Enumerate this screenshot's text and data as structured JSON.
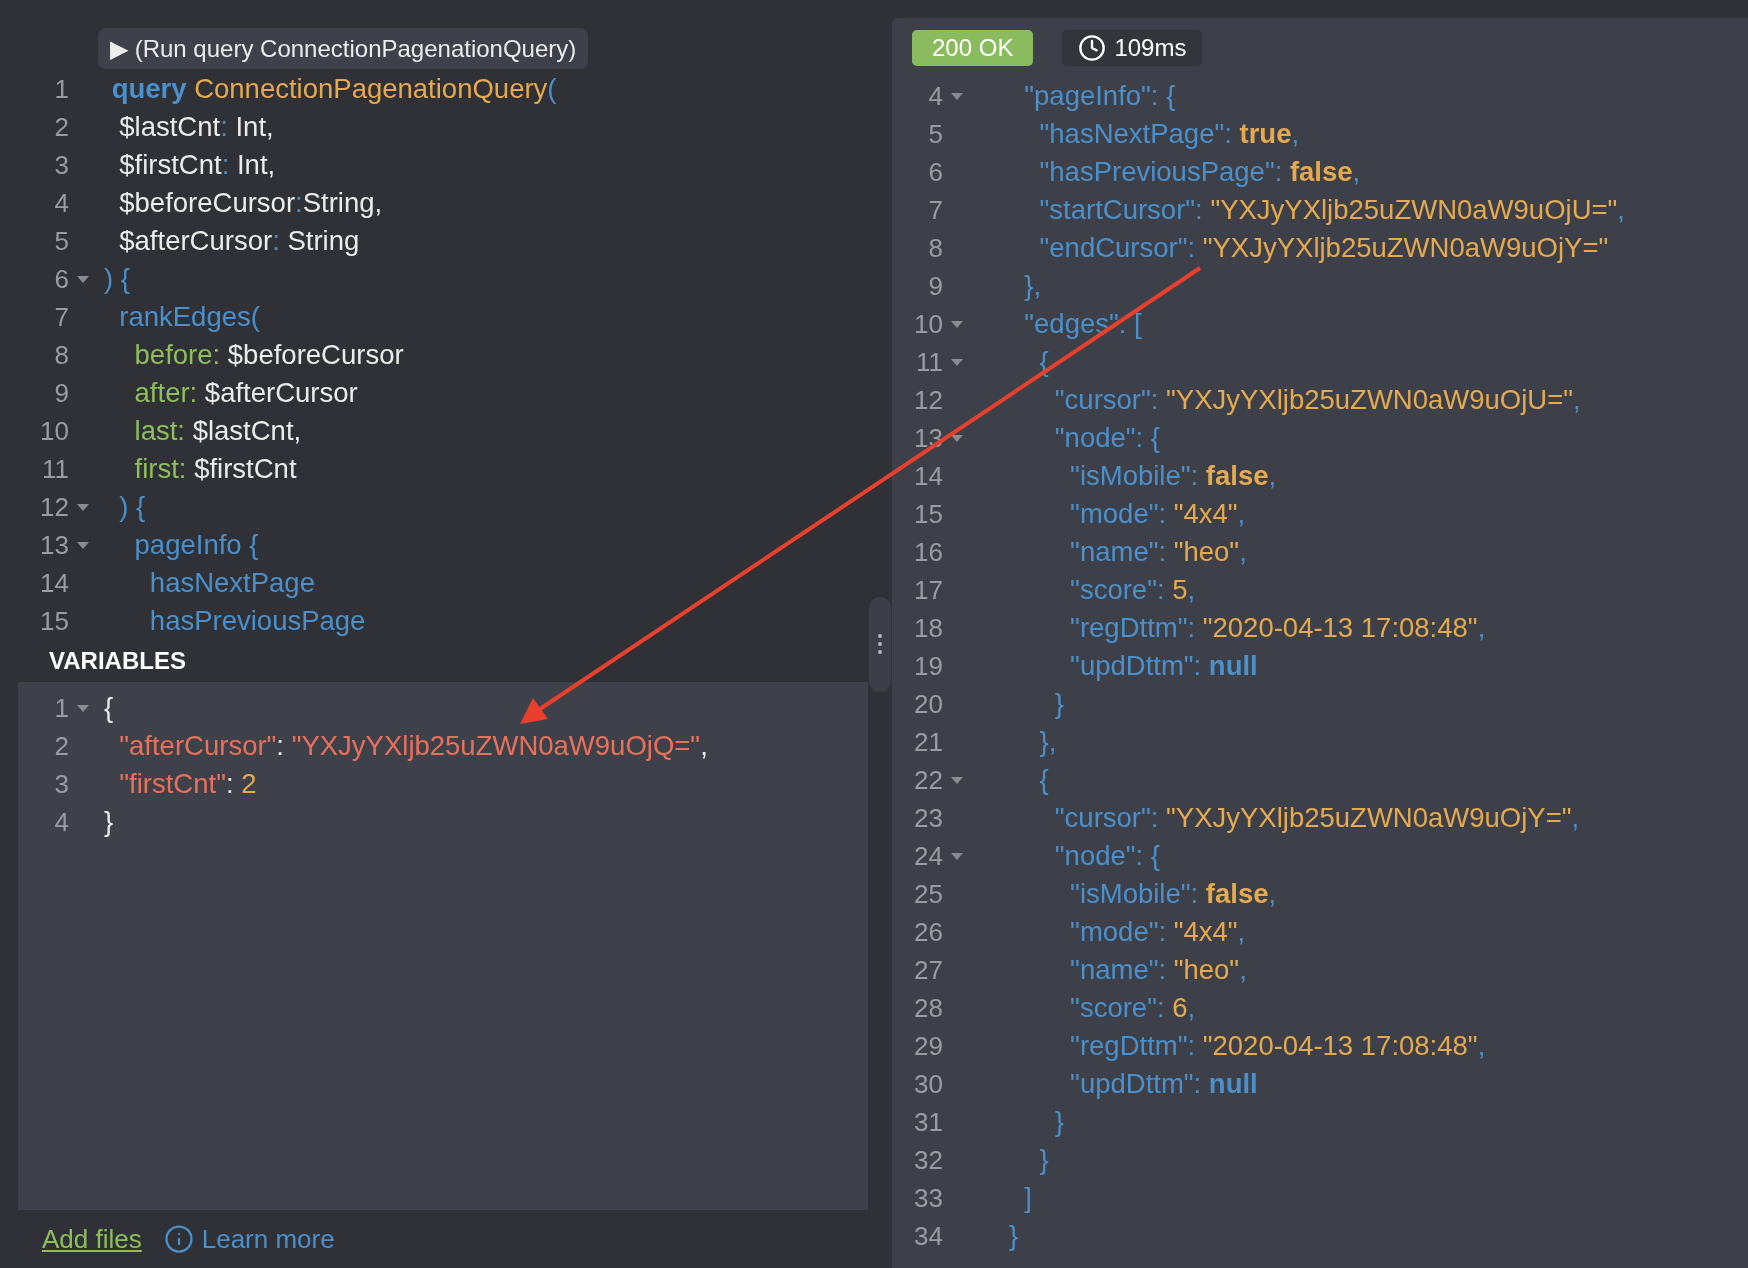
{
  "run_button": {
    "label": "▶ (Run query ConnectionPagenationQuery)"
  },
  "query_lines": [
    {
      "n": "1",
      "tokens": [
        {
          "kind": "kw",
          "text": " query"
        },
        {
          "kind": "name",
          "text": " ConnectionPagenationQuery"
        },
        {
          "kind": "punct",
          "text": "("
        }
      ]
    },
    {
      "n": "2",
      "tokens": [
        {
          "kind": "plain",
          "text": "  $lastCnt"
        },
        {
          "kind": "punct",
          "text": ":"
        },
        {
          "kind": "plain",
          "text": " Int,"
        }
      ]
    },
    {
      "n": "3",
      "tokens": [
        {
          "kind": "plain",
          "text": "  $firstCnt"
        },
        {
          "kind": "punct",
          "text": ":"
        },
        {
          "kind": "plain",
          "text": " Int,"
        }
      ]
    },
    {
      "n": "4",
      "tokens": [
        {
          "kind": "plain",
          "text": "  $beforeCursor"
        },
        {
          "kind": "punct",
          "text": ":"
        },
        {
          "kind": "plain",
          "text": "String,"
        }
      ]
    },
    {
      "n": "5",
      "tokens": [
        {
          "kind": "plain",
          "text": "  $afterCursor"
        },
        {
          "kind": "punct",
          "text": ":"
        },
        {
          "kind": "plain",
          "text": " String"
        }
      ]
    },
    {
      "n": "6",
      "expanded": true,
      "tokens": [
        {
          "kind": "punct",
          "text": ") {"
        }
      ]
    },
    {
      "n": "7",
      "tokens": [
        {
          "kind": "field",
          "text": "  rankEdges("
        }
      ]
    },
    {
      "n": "8",
      "tokens": [
        {
          "kind": "arg",
          "text": "    before:"
        },
        {
          "kind": "plain",
          "text": " $beforeCursor"
        }
      ]
    },
    {
      "n": "9",
      "tokens": [
        {
          "kind": "arg",
          "text": "    after:"
        },
        {
          "kind": "plain",
          "text": " $afterCursor"
        }
      ]
    },
    {
      "n": "10",
      "tokens": [
        {
          "kind": "arg",
          "text": "    last:"
        },
        {
          "kind": "plain",
          "text": " $lastCnt,"
        }
      ]
    },
    {
      "n": "11",
      "tokens": [
        {
          "kind": "arg",
          "text": "    first:"
        },
        {
          "kind": "plain",
          "text": " $firstCnt"
        }
      ]
    },
    {
      "n": "12",
      "expanded": true,
      "tokens": [
        {
          "kind": "punct",
          "text": "  ) {"
        }
      ]
    },
    {
      "n": "13",
      "expanded": true,
      "tokens": [
        {
          "kind": "field",
          "text": "    pageInfo {"
        }
      ]
    },
    {
      "n": "14",
      "tokens": [
        {
          "kind": "field",
          "text": "      hasNextPage"
        }
      ]
    },
    {
      "n": "15",
      "tokens": [
        {
          "kind": "field",
          "text": "      hasPreviousPage"
        }
      ]
    }
  ],
  "variables": {
    "title": "VARIABLES",
    "lines": [
      {
        "n": "1",
        "expanded": true,
        "tokens": [
          {
            "kind": "plain",
            "text": "{"
          }
        ]
      },
      {
        "n": "2",
        "tokens": [
          {
            "kind": "vkey",
            "text": "  \"afterCursor\""
          },
          {
            "kind": "plain",
            "text": ": "
          },
          {
            "kind": "vstr",
            "text": "\"YXJyYXljb25uZWN0aW9uOjQ=\""
          },
          {
            "kind": "plain",
            "text": ","
          }
        ]
      },
      {
        "n": "3",
        "tokens": [
          {
            "kind": "vkey",
            "text": "  \"firstCnt\""
          },
          {
            "kind": "plain",
            "text": ": "
          },
          {
            "kind": "num",
            "text": "2"
          }
        ]
      },
      {
        "n": "4",
        "tokens": [
          {
            "kind": "plain",
            "text": "}"
          }
        ]
      }
    ]
  },
  "footer": {
    "add_files": "Add files",
    "learn_more": "Learn more"
  },
  "response": {
    "status": "200 OK",
    "time": "109ms",
    "lines": [
      {
        "n": "4",
        "expanded": true,
        "tokens": [
          {
            "kind": "key",
            "text": "  \"pageInfo\": {"
          }
        ]
      },
      {
        "n": "5",
        "tokens": [
          {
            "kind": "key",
            "text": "    \"hasNextPage\": "
          },
          {
            "kind": "bool",
            "text": "true"
          },
          {
            "kind": "key",
            "text": ","
          }
        ]
      },
      {
        "n": "6",
        "tokens": [
          {
            "kind": "key",
            "text": "    \"hasPreviousPage\": "
          },
          {
            "kind": "bool",
            "text": "false"
          },
          {
            "kind": "key",
            "text": ","
          }
        ]
      },
      {
        "n": "7",
        "tokens": [
          {
            "kind": "key",
            "text": "    \"startCursor\": "
          },
          {
            "kind": "str",
            "text": "\"YXJyYXljb25uZWN0aW9uOjU=\""
          },
          {
            "kind": "key",
            "text": ","
          }
        ]
      },
      {
        "n": "8",
        "tokens": [
          {
            "kind": "key",
            "text": "    \"endCursor\": "
          },
          {
            "kind": "str",
            "text": "\"YXJyYXljb25uZWN0aW9uOjY=\""
          }
        ]
      },
      {
        "n": "9",
        "tokens": [
          {
            "kind": "key",
            "text": "  },"
          }
        ]
      },
      {
        "n": "10",
        "expanded": true,
        "tokens": [
          {
            "kind": "key",
            "text": "  \"edges\": ["
          }
        ]
      },
      {
        "n": "11",
        "expanded": true,
        "tokens": [
          {
            "kind": "key",
            "text": "    {"
          }
        ]
      },
      {
        "n": "12",
        "tokens": [
          {
            "kind": "key",
            "text": "      \"cursor\": "
          },
          {
            "kind": "str",
            "text": "\"YXJyYXljb25uZWN0aW9uOjU=\""
          },
          {
            "kind": "key",
            "text": ","
          }
        ]
      },
      {
        "n": "13",
        "expanded": true,
        "tokens": [
          {
            "kind": "key",
            "text": "      \"node\": {"
          }
        ]
      },
      {
        "n": "14",
        "tokens": [
          {
            "kind": "key",
            "text": "        \"isMobile\": "
          },
          {
            "kind": "bool",
            "text": "false"
          },
          {
            "kind": "key",
            "text": ","
          }
        ]
      },
      {
        "n": "15",
        "tokens": [
          {
            "kind": "key",
            "text": "        \"mode\": "
          },
          {
            "kind": "str",
            "text": "\"4x4\""
          },
          {
            "kind": "key",
            "text": ","
          }
        ]
      },
      {
        "n": "16",
        "tokens": [
          {
            "kind": "key",
            "text": "        \"name\": "
          },
          {
            "kind": "str",
            "text": "\"heo\""
          },
          {
            "kind": "key",
            "text": ","
          }
        ]
      },
      {
        "n": "17",
        "tokens": [
          {
            "kind": "key",
            "text": "        \"score\": "
          },
          {
            "kind": "str",
            "text": "5"
          },
          {
            "kind": "key",
            "text": ","
          }
        ]
      },
      {
        "n": "18",
        "tokens": [
          {
            "kind": "key",
            "text": "        \"regDttm\": "
          },
          {
            "kind": "str",
            "text": "\"2020-04-13 17:08:48\""
          },
          {
            "kind": "key",
            "text": ","
          }
        ]
      },
      {
        "n": "19",
        "tokens": [
          {
            "kind": "key",
            "text": "        \"updDttm\": "
          },
          {
            "kind": "null",
            "text": "null"
          }
        ]
      },
      {
        "n": "20",
        "tokens": [
          {
            "kind": "key",
            "text": "      }"
          }
        ]
      },
      {
        "n": "21",
        "tokens": [
          {
            "kind": "key",
            "text": "    },"
          }
        ]
      },
      {
        "n": "22",
        "expanded": true,
        "tokens": [
          {
            "kind": "key",
            "text": "    {"
          }
        ]
      },
      {
        "n": "23",
        "tokens": [
          {
            "kind": "key",
            "text": "      \"cursor\": "
          },
          {
            "kind": "str",
            "text": "\"YXJyYXljb25uZWN0aW9uOjY=\""
          },
          {
            "kind": "key",
            "text": ","
          }
        ]
      },
      {
        "n": "24",
        "expanded": true,
        "tokens": [
          {
            "kind": "key",
            "text": "      \"node\": {"
          }
        ]
      },
      {
        "n": "25",
        "tokens": [
          {
            "kind": "key",
            "text": "        \"isMobile\": "
          },
          {
            "kind": "bool",
            "text": "false"
          },
          {
            "kind": "key",
            "text": ","
          }
        ]
      },
      {
        "n": "26",
        "tokens": [
          {
            "kind": "key",
            "text": "        \"mode\": "
          },
          {
            "kind": "str",
            "text": "\"4x4\""
          },
          {
            "kind": "key",
            "text": ","
          }
        ]
      },
      {
        "n": "27",
        "tokens": [
          {
            "kind": "key",
            "text": "        \"name\": "
          },
          {
            "kind": "str",
            "text": "\"heo\""
          },
          {
            "kind": "key",
            "text": ","
          }
        ]
      },
      {
        "n": "28",
        "tokens": [
          {
            "kind": "key",
            "text": "        \"score\": "
          },
          {
            "kind": "str",
            "text": "6"
          },
          {
            "kind": "key",
            "text": ","
          }
        ]
      },
      {
        "n": "29",
        "tokens": [
          {
            "kind": "key",
            "text": "        \"regDttm\": "
          },
          {
            "kind": "str",
            "text": "\"2020-04-13 17:08:48\""
          },
          {
            "kind": "key",
            "text": ","
          }
        ]
      },
      {
        "n": "30",
        "tokens": [
          {
            "kind": "key",
            "text": "        \"updDttm\": "
          },
          {
            "kind": "null",
            "text": "null"
          }
        ]
      },
      {
        "n": "31",
        "tokens": [
          {
            "kind": "key",
            "text": "      }"
          }
        ]
      },
      {
        "n": "32",
        "tokens": [
          {
            "kind": "key",
            "text": "    }"
          }
        ]
      },
      {
        "n": "33",
        "tokens": [
          {
            "kind": "key",
            "text": "  ]"
          }
        ]
      },
      {
        "n": "34",
        "tokens": [
          {
            "kind": "key",
            "text": "}"
          }
        ]
      }
    ]
  }
}
